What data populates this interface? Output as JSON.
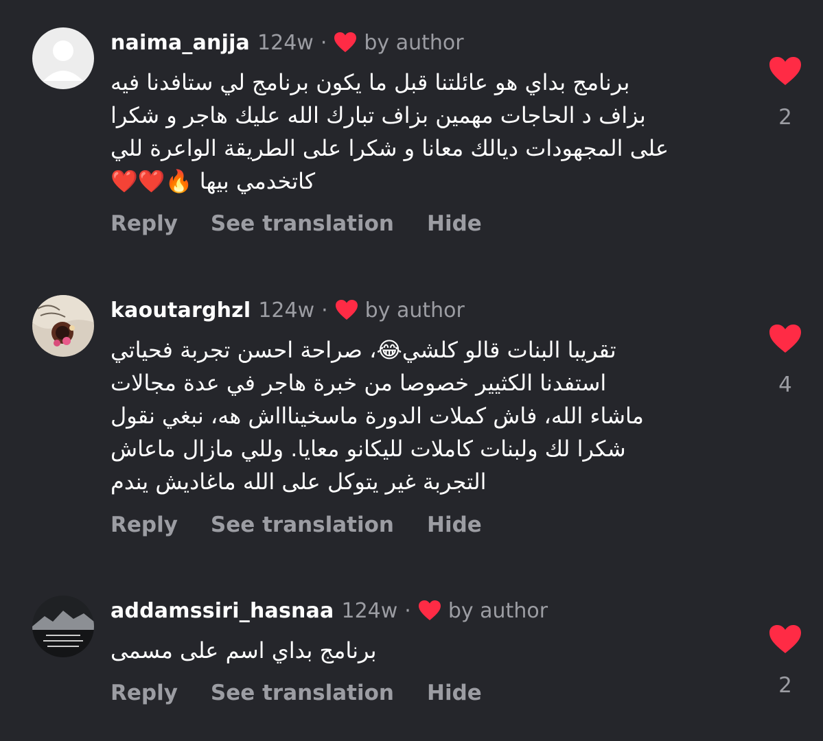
{
  "accent_color": "#ff2b45",
  "comments": [
    {
      "username": "naima_anjja",
      "age": "124w",
      "separator": "·",
      "author_liked": "by author",
      "avatar_icon": "default-avatar-icon",
      "lines": [
        "برنامج بداي هو عائلتنا قبل ما يكون برنامج لي ستافدنا فيه",
        "بزاف د الحاجات مهمين بزاف تبارك الله عليك هاجر و شكرا",
        "على المجهودات ديالك معانا و شكرا على الطريقة الواعرة للي",
        "كاتخدمي بيها 🔥❤️❤️"
      ],
      "reply": "Reply",
      "see_translation": "See translation",
      "hide": "Hide",
      "like_count": "2"
    },
    {
      "username": "kaoutarghzl",
      "age": "124w",
      "separator": "·",
      "author_liked": "by author",
      "avatar_icon": "photo-avatar-icon",
      "lines": [
        "تقريبا البنات قالو كلشي😂، صراحة احسن تجربة فحياتي",
        "استفدنا الكثيير خصوصا من خبرة هاجر في عدة مجالات",
        "ماشاء الله، فاش كملات الدورة ماسخيناااش هه، نبغي نقول",
        "شكرا لك ولبنات كاملات لليكانو معايا. وللي مازال ماعاش",
        "التجربة غير يتوكل على الله ماغاديش يندم"
      ],
      "reply": "Reply",
      "see_translation": "See translation",
      "hide": "Hide",
      "like_count": "4"
    },
    {
      "username": "addamssiri_hasnaa",
      "age": "124w",
      "separator": "·",
      "author_liked": "by author",
      "avatar_icon": "photo-avatar-icon",
      "lines": [
        "برنامج بداي اسم على مسمى"
      ],
      "reply": "Reply",
      "see_translation": "See translation",
      "hide": "Hide",
      "like_count": "2"
    }
  ]
}
